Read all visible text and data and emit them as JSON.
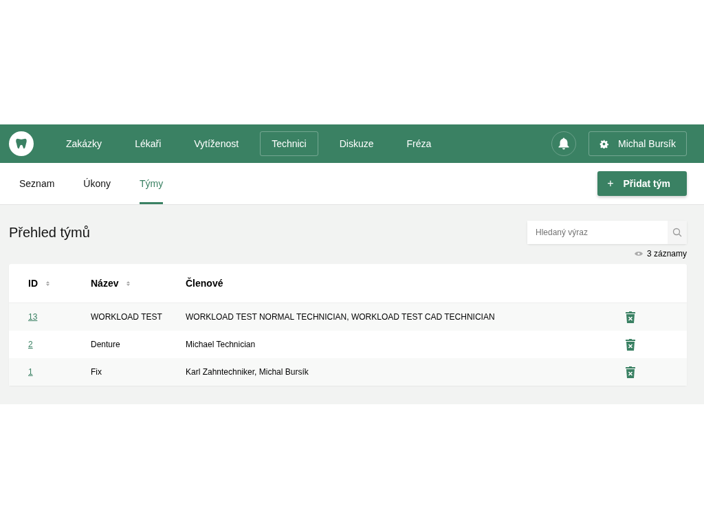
{
  "nav": {
    "items": [
      {
        "label": "Zakázky",
        "selected": false
      },
      {
        "label": "Lékaři",
        "selected": false
      },
      {
        "label": "Vytíženost",
        "selected": false
      },
      {
        "label": "Technici",
        "selected": true
      },
      {
        "label": "Diskuze",
        "selected": false
      },
      {
        "label": "Fréza",
        "selected": false
      }
    ],
    "user": "Michal Bursík"
  },
  "subtabs": [
    {
      "label": "Seznam",
      "selected": false
    },
    {
      "label": "Úkony",
      "selected": false
    },
    {
      "label": "Týmy",
      "selected": true
    }
  ],
  "add_button": {
    "icon": "+",
    "label": "Přidat tým"
  },
  "heading": "Přehled týmů",
  "search": {
    "placeholder": "Hledaný výraz"
  },
  "record_count": "3 záznamy",
  "table": {
    "columns": [
      {
        "label": "ID",
        "sortable": true
      },
      {
        "label": "Název",
        "sortable": true
      },
      {
        "label": "Členové",
        "sortable": false
      }
    ],
    "rows": [
      {
        "id": "13",
        "name": "WORKLOAD TEST",
        "members": "WORKLOAD TEST NORMAL TECHNICIAN, WORKLOAD TEST CAD TECHNICIAN"
      },
      {
        "id": "2",
        "name": "Denture",
        "members": "Michael Technician"
      },
      {
        "id": "1",
        "name": "Fix",
        "members": "Karl Zahntechniker, Michal Bursík"
      }
    ]
  }
}
